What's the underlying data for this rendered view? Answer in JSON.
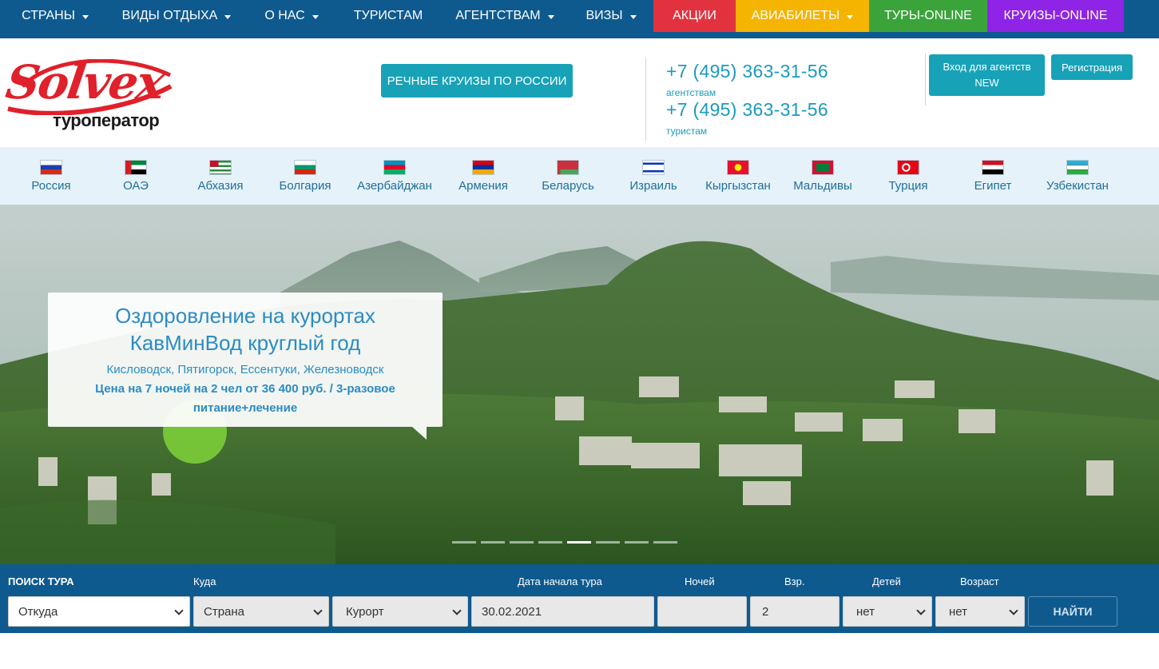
{
  "topnav": {
    "items": [
      {
        "label": "СТРАНЫ",
        "caret": true
      },
      {
        "label": "ВИДЫ ОТДЫХА",
        "caret": true
      },
      {
        "label": "О НАС",
        "caret": true
      },
      {
        "label": "ТУРИСТАМ",
        "caret": false
      },
      {
        "label": "АГЕНТСТВАМ",
        "caret": true
      },
      {
        "label": "ВИЗЫ",
        "caret": true
      }
    ],
    "colored": [
      {
        "label": "АКЦИИ",
        "color": "#e3323f"
      },
      {
        "label": "АВИАБИЛЕТЫ",
        "color": "#f5b400"
      },
      {
        "label": "ТУРЫ-ONLINE",
        "color": "#3aa43a"
      },
      {
        "label": "КРУИЗЫ-ONLINE",
        "color": "#8f24e6"
      }
    ]
  },
  "header": {
    "logo_text": "Solvex",
    "logo_sub": "туроператор",
    "river_button": "РЕЧНЫЕ КРУИЗЫ ПО РОССИИ",
    "phone_agents": "+7 (495) 363-31-56",
    "phone_agents_caption": "агентствам",
    "phone_tourists": "+7 (495) 363-31-56",
    "phone_tourists_caption": "туристам",
    "agent_login_line1": "Вход для агентств",
    "agent_login_line2": "NEW",
    "register": "Регистрация"
  },
  "countries": [
    {
      "name": "Россия",
      "flag": "russia-flag"
    },
    {
      "name": "ОАЭ",
      "flag": "uae-flag"
    },
    {
      "name": "Абхазия",
      "flag": "abkhazia-flag"
    },
    {
      "name": "Болгария",
      "flag": "bulgaria-flag"
    },
    {
      "name": "Азербайджан",
      "flag": "azerbaijan-flag"
    },
    {
      "name": "Армения",
      "flag": "armenia-flag"
    },
    {
      "name": "Беларусь",
      "flag": "belarus-flag"
    },
    {
      "name": "Израиль",
      "flag": "israel-flag"
    },
    {
      "name": "Кыргызстан",
      "flag": "kyrgyzstan-flag"
    },
    {
      "name": "Мальдивы",
      "flag": "maldives-flag"
    },
    {
      "name": "Турция",
      "flag": "turkey-flag"
    },
    {
      "name": "Египет",
      "flag": "egypt-flag"
    },
    {
      "name": "Узбекистан",
      "flag": "uzbekistan-flag"
    }
  ],
  "hero": {
    "title": "Оздоровление на курортах КавМинВод круглый год",
    "subtitle": "Кисловодск, Пятигорск, Ессентуки, Железноводск",
    "price": "Цена на 7 ночей на 2 чел от 36 400 руб. / 3-разовое питание+лечение",
    "slides_total": 8,
    "active_slide": 5
  },
  "search": {
    "title": "ПОИСК ТУРА",
    "where_label": "Куда",
    "date_label": "Дата начала тура",
    "nights_label": "Ночей",
    "adults_label": "Взр.",
    "kids_label": "Детей",
    "age_label": "Возраст",
    "from_value": "Откуда",
    "country_value": "Страна",
    "resort_value": "Курорт",
    "date_value": "30.02.2021",
    "nights_value": "",
    "adults_value": "2",
    "kids_value": "нет",
    "age_value": "нет",
    "submit": "НАЙТИ"
  }
}
